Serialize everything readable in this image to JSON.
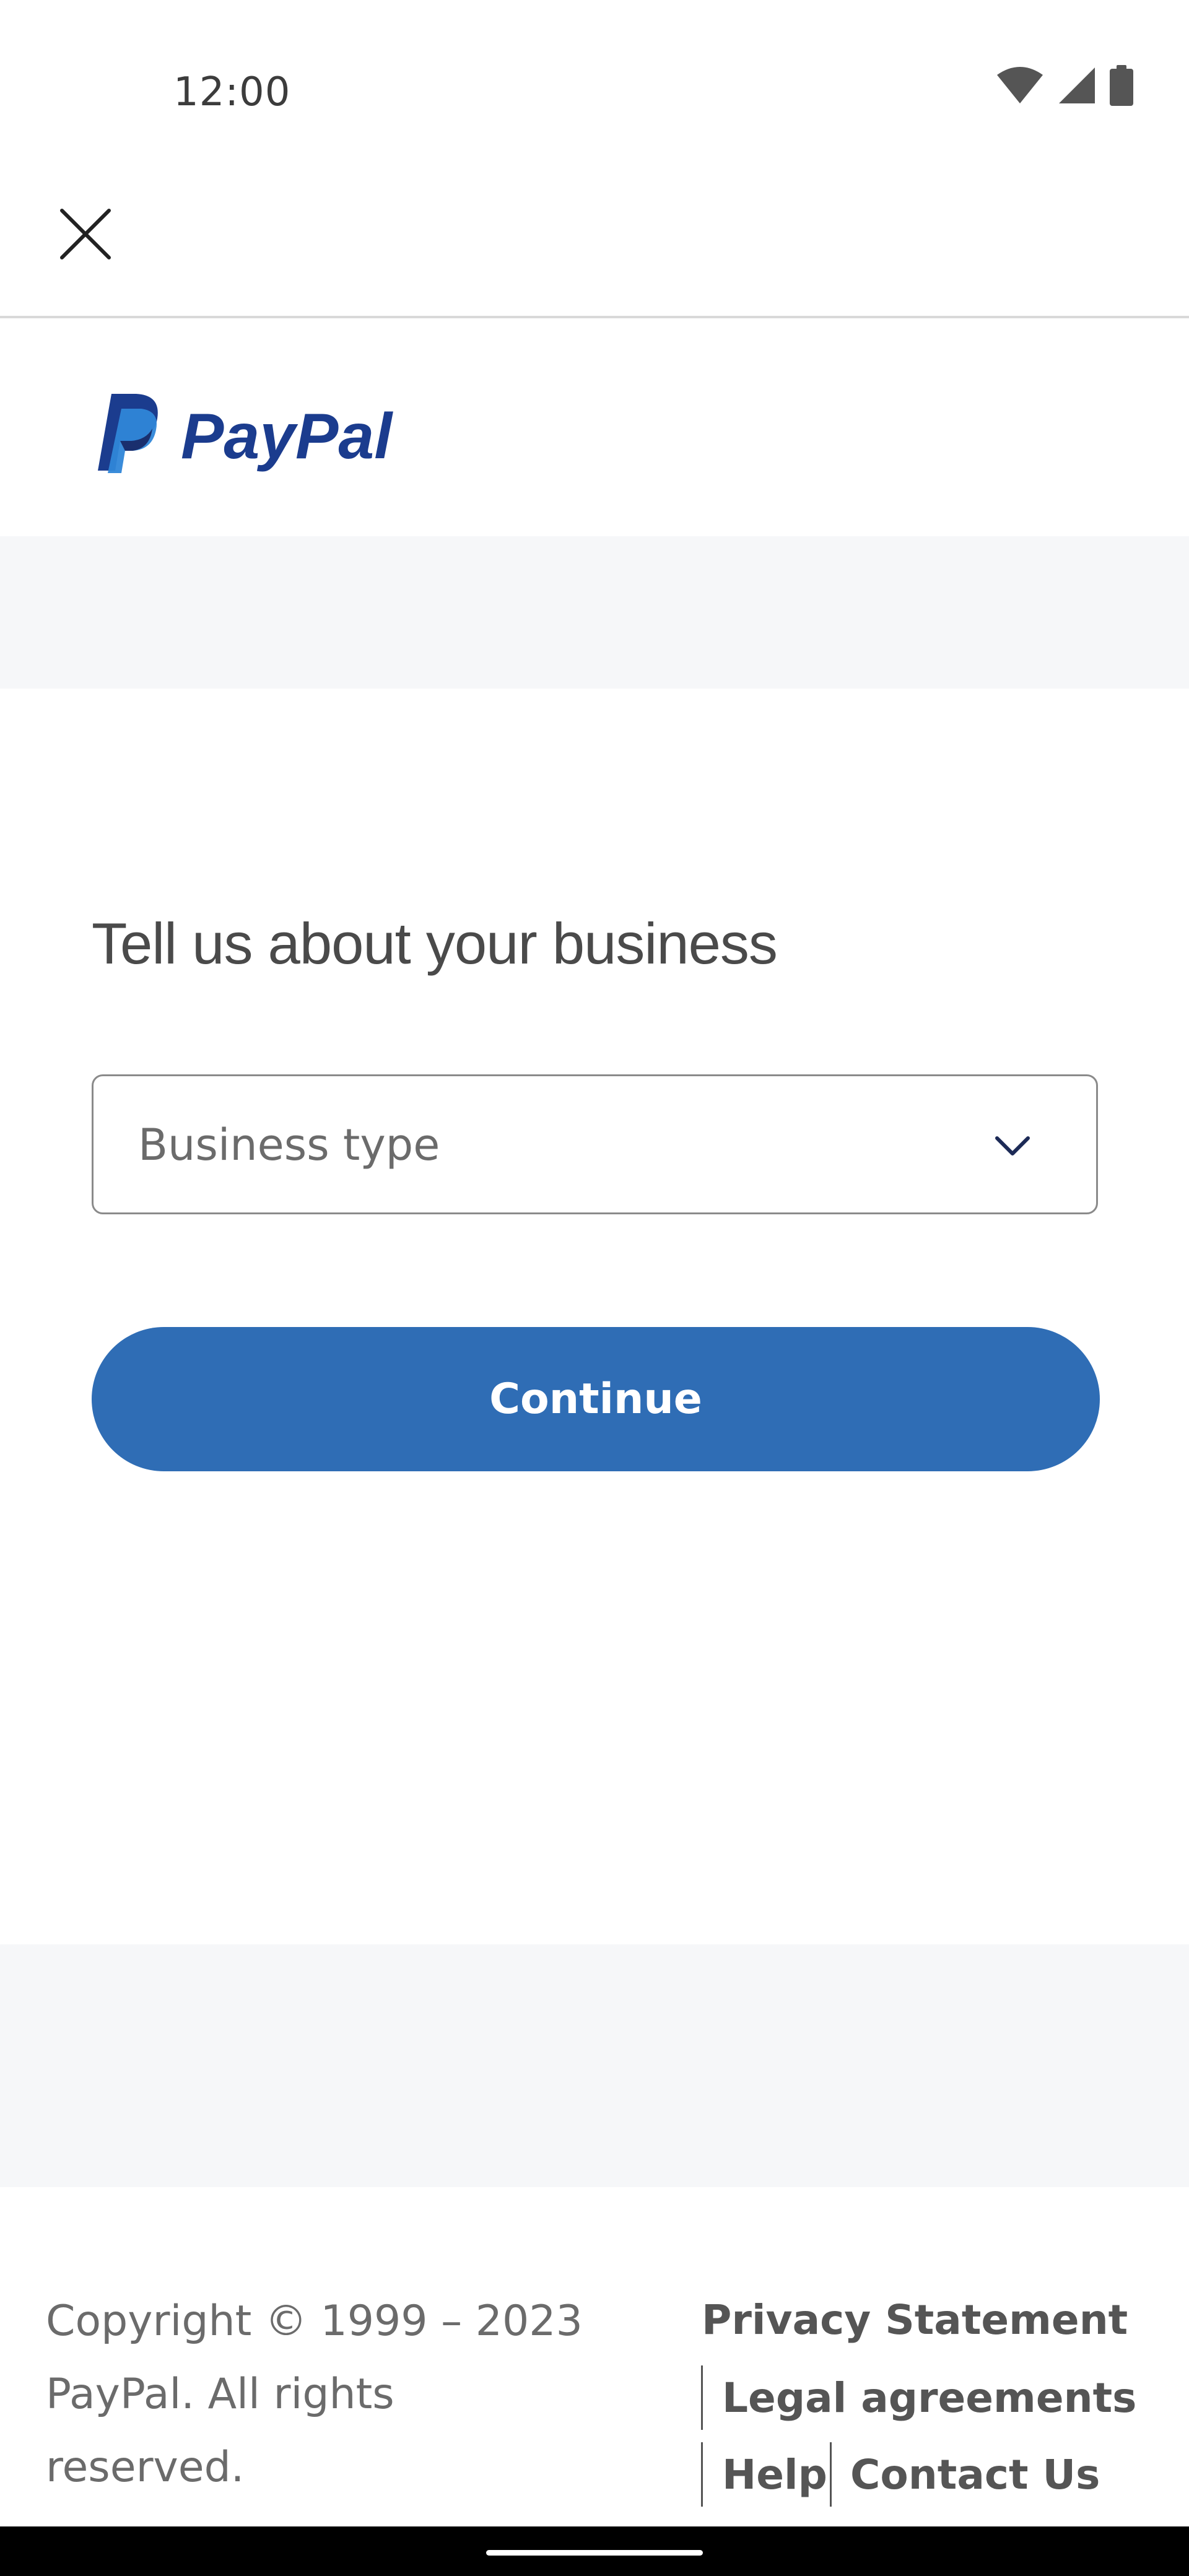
{
  "status_bar": {
    "time": "12:00",
    "icons": [
      "wifi-icon",
      "cellular-signal-icon",
      "battery-icon"
    ]
  },
  "header": {
    "close_icon": "close-icon"
  },
  "logo": {
    "text": "PayPal",
    "colors": {
      "dark": "#1b3c8e",
      "light": "#2f86d8"
    }
  },
  "main": {
    "heading": "Tell us about your business",
    "business_type": {
      "placeholder": "Business type",
      "icon": "chevron-down-icon"
    },
    "continue_label": "Continue",
    "accent_color": "#2f6db5"
  },
  "footer": {
    "copyright_lines": [
      "Copyright © 1999 – 2023",
      "PayPal. All rights",
      "reserved."
    ],
    "links": {
      "privacy": "Privacy Statement",
      "legal": "Legal agreements",
      "help": "Help",
      "contact": "Contact Us"
    }
  }
}
